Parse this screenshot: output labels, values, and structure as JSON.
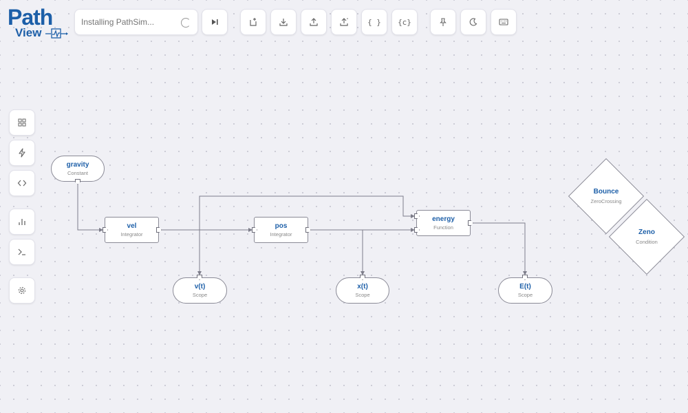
{
  "app": {
    "logo_line1": "Path",
    "logo_line2": "View"
  },
  "toolbar": {
    "status_placeholder": "Installing PathSim...",
    "buttons": [
      {
        "name": "step-forward-icon"
      },
      {
        "name": "new-file-icon"
      },
      {
        "name": "download-icon"
      },
      {
        "name": "upload-icon"
      },
      {
        "name": "export-icon"
      },
      {
        "name": "json-icon",
        "label": "{ }"
      },
      {
        "name": "code-export-icon",
        "label": "{c}"
      },
      {
        "name": "pin-icon"
      },
      {
        "name": "dark-mode-icon"
      },
      {
        "name": "keyboard-icon"
      }
    ]
  },
  "sidebar": {
    "items": [
      {
        "name": "blocks-grid-icon"
      },
      {
        "name": "events-bolt-icon"
      },
      {
        "name": "code-icon"
      },
      {
        "name": "plot-chart-icon"
      },
      {
        "name": "terminal-icon"
      },
      {
        "name": "settings-gear-icon"
      }
    ]
  },
  "blocks": [
    {
      "id": "gravity",
      "name": "gravity",
      "type": "Constant"
    },
    {
      "id": "vel",
      "name": "vel",
      "type": "Integrator"
    },
    {
      "id": "pos",
      "name": "pos",
      "type": "Integrator"
    },
    {
      "id": "energy",
      "name": "energy",
      "type": "Function"
    },
    {
      "id": "vt",
      "name": "v(t)",
      "type": "Scope"
    },
    {
      "id": "xt",
      "name": "x(t)",
      "type": "Scope"
    },
    {
      "id": "et",
      "name": "E(t)",
      "type": "Scope"
    }
  ],
  "events": [
    {
      "id": "bounce",
      "name": "Bounce",
      "type": "ZeroCrossing"
    },
    {
      "id": "zeno",
      "name": "Zeno",
      "type": "Condition"
    }
  ],
  "colors": {
    "accent": "#1d5fa8",
    "background": "#f0f0f5",
    "wire": "#7d7d8a"
  }
}
